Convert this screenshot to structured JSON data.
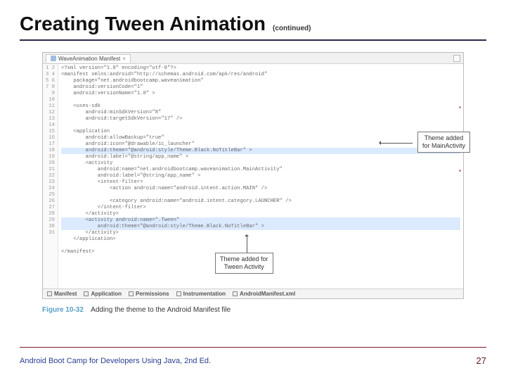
{
  "title": "Creating Tween Animation",
  "continued": "(continued)",
  "editor": {
    "tab_label": "WaveAnimation Manifest",
    "bottom_tabs": [
      "Manifest",
      "Application",
      "Permissions",
      "Instrumentation",
      "AndroidManifest.xml"
    ],
    "lines": [
      "1",
      "2",
      "3",
      "4",
      "5",
      "6",
      "7",
      "8",
      "9",
      "10",
      "11",
      "12",
      "13",
      "14",
      "15",
      "16",
      "17",
      "18",
      "19",
      "20",
      "21",
      "22",
      "23",
      "24",
      "25",
      "26",
      "27",
      "28",
      "29",
      "30",
      "31"
    ],
    "code": "<?xml version=\"1.0\" encoding=\"utf-8\"?>\n<manifest xmlns:android=\"http://schemas.android.com/apk/res/android\"\n    package=\"net.androidbootcamp.waveanimation\"\n    android:versionCode=\"1\"\n    android:versionName=\"1.0\" >\n\n    <uses-sdk\n        android:minSdkVersion=\"8\"\n        android:targetSdkVersion=\"17\" />\n\n    <application\n        android:allowBackup=\"true\"\n        android:icon=\"@drawable/ic_launcher\"\n        android:theme=\"@android:style/Theme.Black.NoTitleBar\" >\n        android:label=\"@string/app_name\" >\n        <activity\n            android:name=\"net.androidbootcamp.waveanimation.MainActivity\"\n            android:label=\"@string/app_name\" >\n            <intent-filter>\n                <action android:name=\"android.intent.action.MAIN\" />\n\n                <category android:name=\"android.intent.category.LAUNCHER\" />\n            </intent-filter>\n        </activity>\n        <activity android:name=\".Tween\"\n            android:theme=\"@android:style/Theme.Black.NoTitleBar\" >\n        </activity>\n    </application>\n\n</manifest>\n"
  },
  "callouts": {
    "right": "Theme added\nfor MainActivity",
    "bottom": "Theme added for\nTween Activity"
  },
  "figure": {
    "number": "Figure 10-32",
    "caption": "Adding the theme to the Android Manifest file"
  },
  "footer": {
    "left": "Android Boot Camp for Developers Using Java, 2nd Ed.",
    "page": "27"
  }
}
